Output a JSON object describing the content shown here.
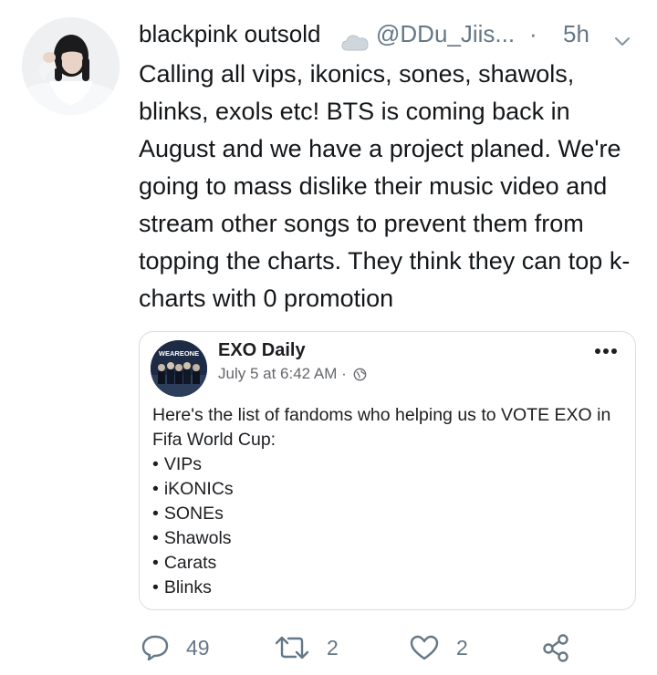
{
  "tweet": {
    "display_name": "blackpink outsold",
    "handle": "@DDu_Jiis...",
    "separator": "·",
    "time": "5h",
    "text": "Calling all vips, ikonics, sones, shawols, blinks, exols etc! BTS is coming back in August and we have a project planed. We're going to mass dislike their music video and stream other songs to prevent them from topping the charts. They think they can top k-charts with 0 promotion"
  },
  "embedded_post": {
    "page_name": "EXO Daily",
    "avatar_text": "WEAREONE",
    "meta": "July 5 at 6:42 AM ·",
    "intro": "Here's the list of fandoms who helping us to VOTE EXO in Fifa World Cup:",
    "fandoms": [
      "VIPs",
      "iKONICs",
      "SONEs",
      "Shawols",
      "Carats",
      "Blinks"
    ]
  },
  "actions": {
    "reply_count": "49",
    "retweet_count": "2",
    "like_count": "2"
  },
  "colors": {
    "primary_text": "#14171a",
    "secondary_text": "#657786",
    "card_border": "#d8dee3"
  },
  "icons": [
    "cloud-emoji-icon",
    "chevron-down-icon",
    "more-options-icon",
    "globe-icon",
    "reply-icon",
    "retweet-icon",
    "like-icon",
    "share-icon"
  ]
}
